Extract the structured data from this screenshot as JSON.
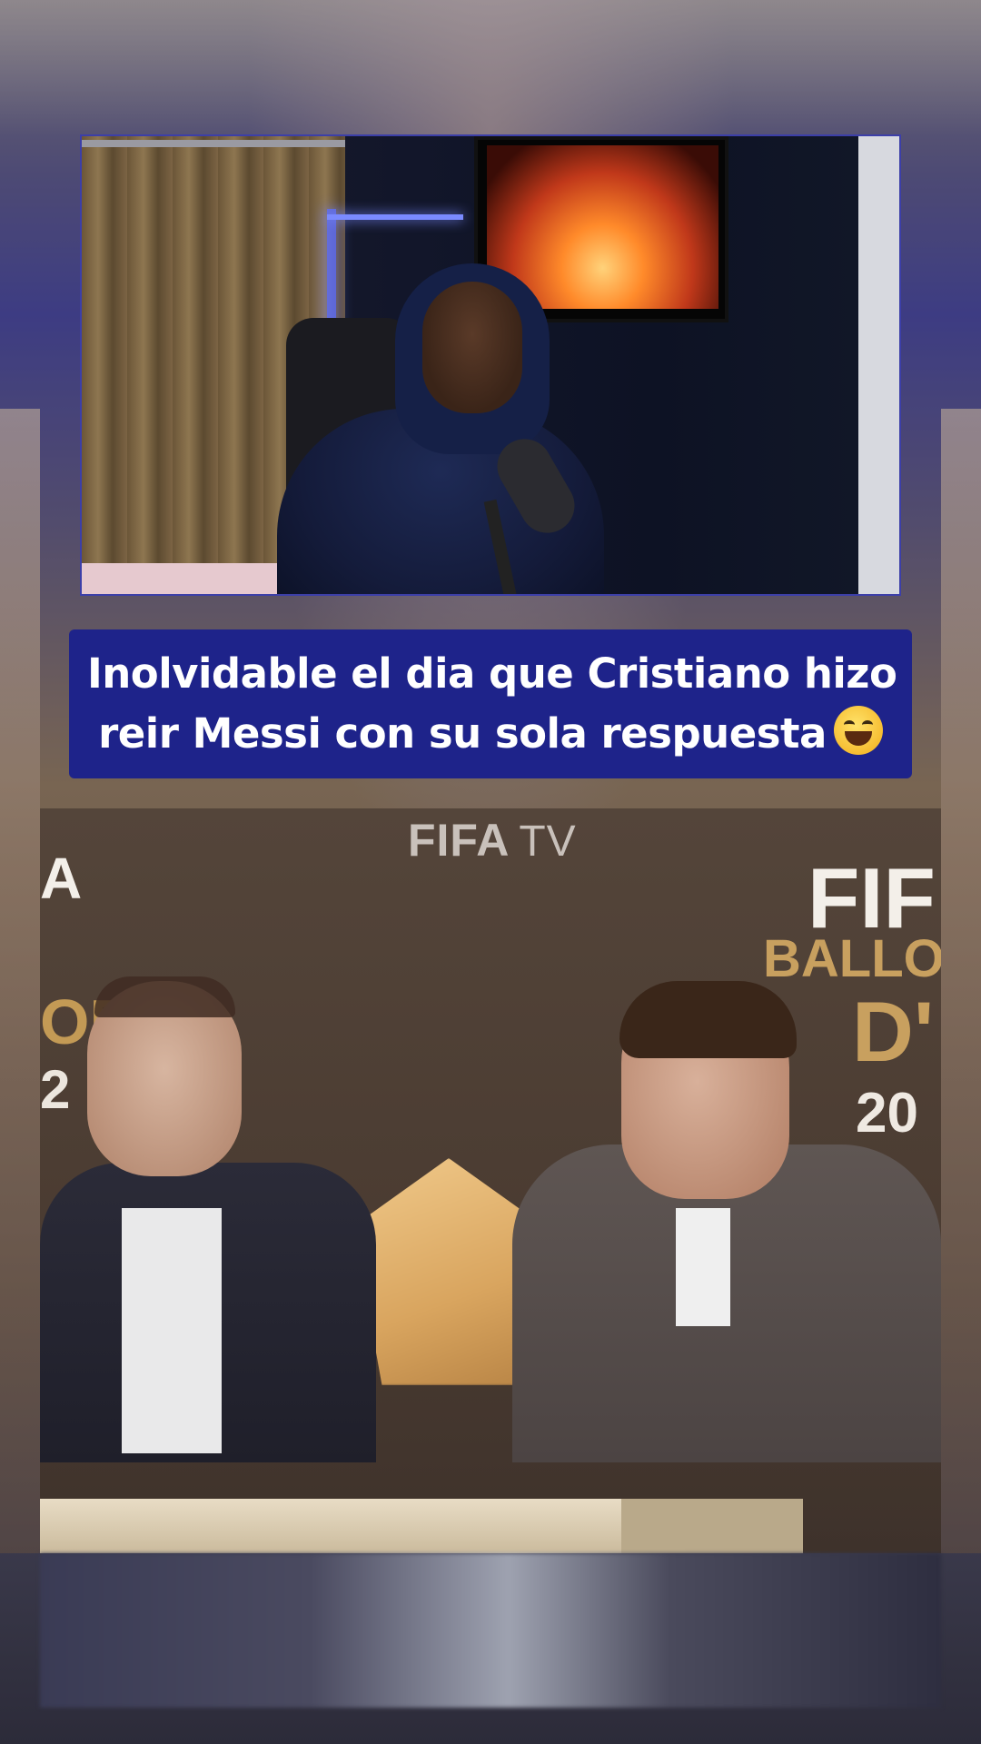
{
  "caption": {
    "line1": "Inolvidable el dia que Cristiano hizo",
    "line2": "reir Messi con su sola respuesta",
    "emoji": "grinning-squinting-face"
  },
  "broadcast": {
    "watermark_fifa": "FIFA",
    "watermark_tv": "TV",
    "left_logo_fragment": "A",
    "left_gold_fragment": "OR",
    "left_year_fragment": "2",
    "right_logo": "FIF",
    "right_ballon": "BALLO",
    "right_dor": "D'",
    "right_year": "20"
  }
}
